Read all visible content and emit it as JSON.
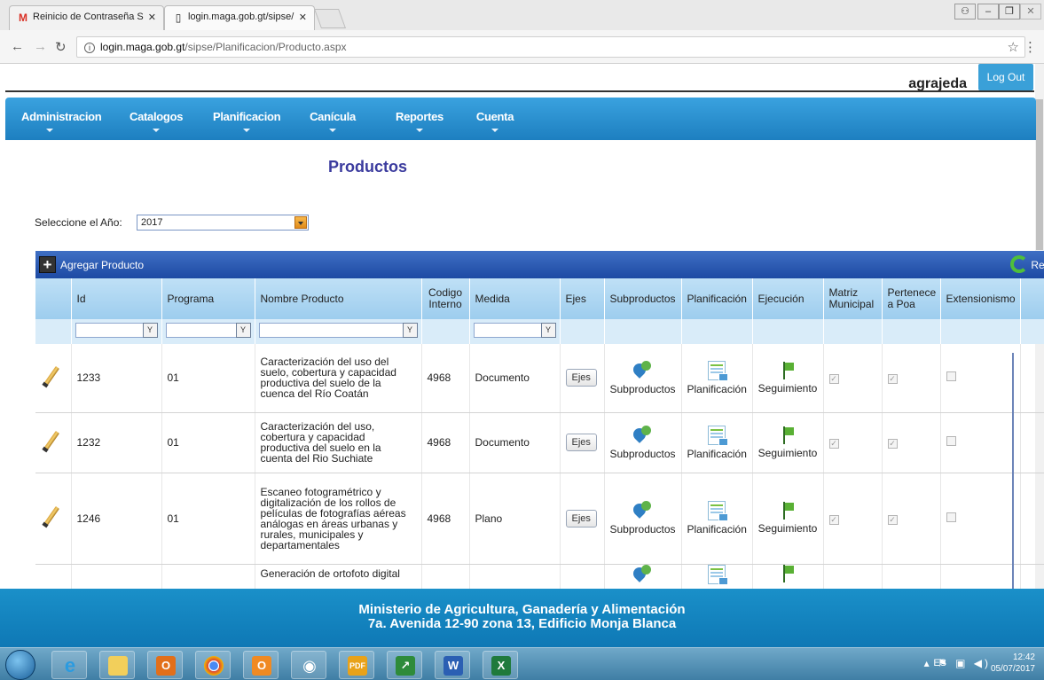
{
  "browser": {
    "tabs": [
      {
        "title": "Reinicio de Contraseña S",
        "icon": "gmail-icon"
      },
      {
        "title": "login.maga.gob.gt/sipse/",
        "icon": "page-icon"
      }
    ],
    "url_host": "login.maga.gob.gt",
    "url_path": "/sipse/Planificacion/Producto.aspx"
  },
  "header": {
    "username": "agrajeda",
    "logout_label": "Log Out"
  },
  "menu": {
    "items": [
      "Administracion",
      "Catalogos",
      "Planificacion",
      "Canícula",
      "Reportes",
      "Cuenta"
    ]
  },
  "page": {
    "title": "Productos",
    "year_label": "Seleccione el Año:",
    "year_value": "2017"
  },
  "grid": {
    "add_label": "Agregar Producto",
    "refresh_label": "Refr",
    "columns": [
      "",
      "Id",
      "Programa",
      "Nombre Producto",
      "Codigo Interno",
      "Medida",
      "Ejes",
      "Subproductos",
      "Planificación",
      "Ejecución",
      "Matriz Municipal",
      "Pertenece a Poa",
      "Extensionismo"
    ],
    "rows": [
      {
        "id": "1233",
        "programa": "01",
        "nombre": "Caracterización del uso del suelo, cobertura y capacidad productiva del suelo de la cuenca del Río Coatán",
        "codigo": "4968",
        "medida": "Documento",
        "ejes": "Ejes",
        "subproductos": "Subproductos",
        "planificacion": "Planificación",
        "ejecucion": "Seguimiento",
        "matriz": true,
        "poa": true,
        "extensionismo": false
      },
      {
        "id": "1232",
        "programa": "01",
        "nombre": "Caracterización del uso, cobertura y capacidad productiva del suelo en la cuenta del Rio Suchiate",
        "codigo": "4968",
        "medida": "Documento",
        "ejes": "Ejes",
        "subproductos": "Subproductos",
        "planificacion": "Planificación",
        "ejecucion": "Seguimiento",
        "matriz": true,
        "poa": true,
        "extensionismo": false
      },
      {
        "id": "1246",
        "programa": "01",
        "nombre": "Escaneo fotogramétrico y digitalización de los rollos de películas de fotografías aéreas análogas en áreas urbanas y rurales, municipales y departamentales",
        "codigo": "4968",
        "medida": "Plano",
        "ejes": "Ejes",
        "subproductos": "Subproductos",
        "planificacion": "Planificación",
        "ejecucion": "Seguimiento",
        "matriz": true,
        "poa": true,
        "extensionismo": false
      },
      {
        "id": "",
        "programa": "",
        "nombre": "Generación de ortofoto digital",
        "codigo": "",
        "medida": "",
        "ejes": "",
        "subproductos": "",
        "planificacion": "",
        "ejecucion": "",
        "matriz": false,
        "poa": false,
        "extensionismo": false
      }
    ]
  },
  "footer": {
    "line1": "Ministerio de Agricultura, Ganadería y Alimentación",
    "line2": "7a. Avenida 12-90 zona 13, Edificio Monja Blanca"
  },
  "taskbar": {
    "lang": "ES",
    "time": "12:42",
    "date": "05/07/2017"
  },
  "colors": {
    "menu_blue": "#1d7fc0",
    "title_purple": "#3b3b9e",
    "grid_header_blue": "#1d4aa3",
    "footer_blue": "#0e78b5"
  }
}
